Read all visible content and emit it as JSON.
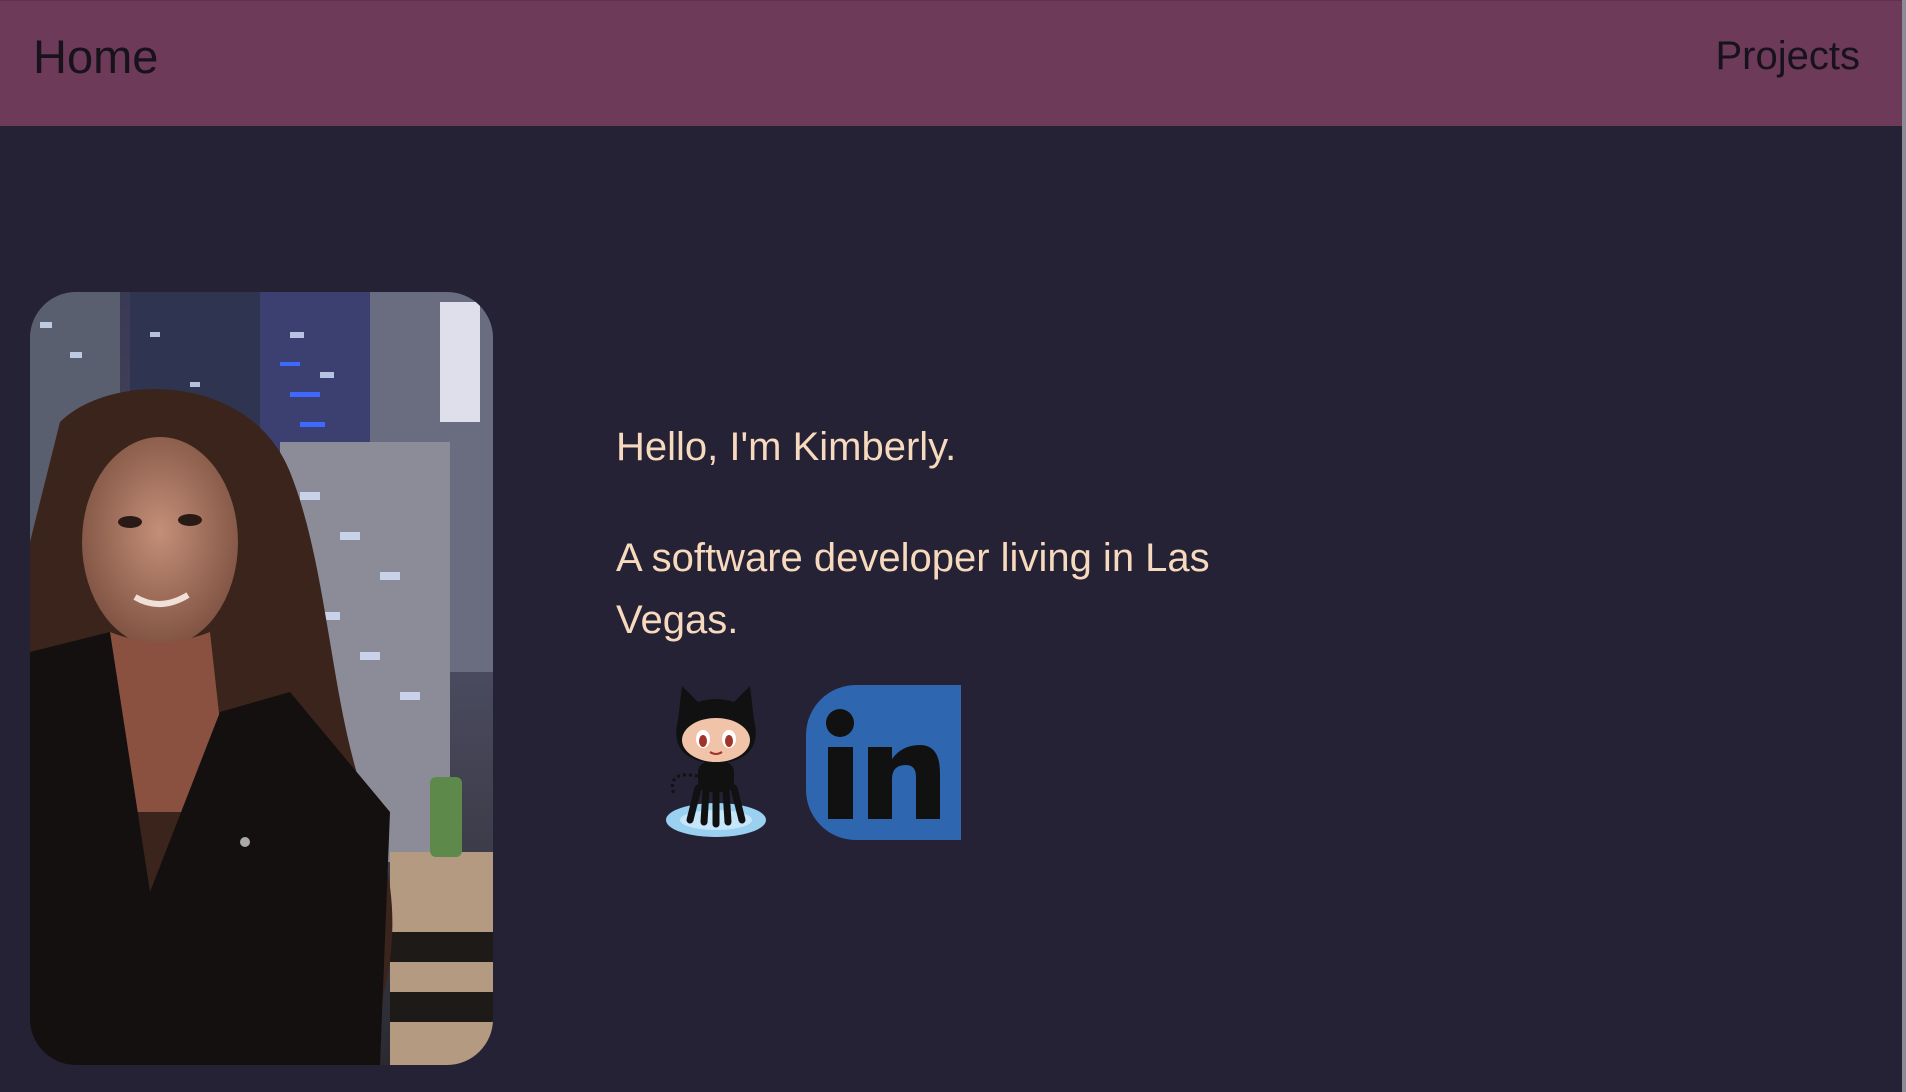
{
  "nav": {
    "home_label": "Home",
    "projects_label": "Projects"
  },
  "profile": {
    "photo_alt": "Kimberly at night with the Las Vegas skyline behind her",
    "greeting": "Hello, I'm Kimberly.",
    "tagline": "A software developer living in Las Vegas."
  },
  "social": {
    "github_icon": "github-octocat-icon",
    "linkedin_icon": "linkedin-icon",
    "linkedin_text": "in"
  },
  "colors": {
    "navbar": "#6e3a59",
    "background": "#252236",
    "text": "#f7d9bd",
    "linkedin": "#2f66b0"
  }
}
